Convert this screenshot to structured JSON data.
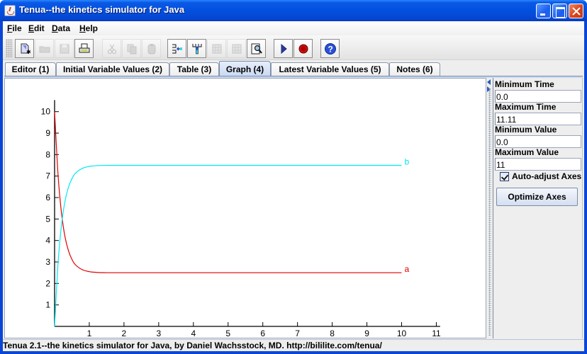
{
  "window": {
    "title": "Tenua--the kinetics simulator for Java",
    "controls": [
      "minimize",
      "maximize",
      "close"
    ]
  },
  "menubar": {
    "items": [
      {
        "label": "File",
        "mnemonic": "F",
        "rest": "ile"
      },
      {
        "label": "Edit",
        "mnemonic": "E",
        "rest": "dit"
      },
      {
        "label": "Data",
        "mnemonic": "D",
        "rest": "ata"
      },
      {
        "label": "Help",
        "mnemonic": "H",
        "rest": "elp"
      }
    ]
  },
  "toolbar": {
    "buttons": [
      {
        "name": "new-document",
        "icon": "new-document-icon",
        "enabled": true
      },
      {
        "name": "open",
        "icon": "folder-open-icon",
        "enabled": false
      },
      {
        "name": "save",
        "icon": "floppy-disk-icon",
        "enabled": false
      },
      {
        "name": "print",
        "icon": "printer-icon",
        "enabled": true
      },
      {
        "name": "cut",
        "icon": "scissors-icon",
        "enabled": false
      },
      {
        "name": "copy",
        "icon": "copy-icon",
        "enabled": false
      },
      {
        "name": "paste",
        "icon": "paste-icon",
        "enabled": false
      },
      {
        "name": "insert-column",
        "icon": "insert-column-icon",
        "enabled": true
      },
      {
        "name": "insert-row",
        "icon": "insert-row-icon",
        "enabled": true
      },
      {
        "name": "table-a",
        "icon": "table-icon",
        "enabled": false
      },
      {
        "name": "table-b",
        "icon": "table-icon",
        "enabled": false
      },
      {
        "name": "inspect",
        "icon": "magnify-document-icon",
        "enabled": true
      },
      {
        "name": "run",
        "icon": "play-icon",
        "enabled": true
      },
      {
        "name": "stop",
        "icon": "stop-icon",
        "enabled": true
      },
      {
        "name": "help",
        "icon": "help-icon",
        "enabled": true
      }
    ]
  },
  "tabs": [
    {
      "label": "Editor (1)",
      "selected": false
    },
    {
      "label": "Initial Variable Values (2)",
      "selected": false
    },
    {
      "label": "Table (3)",
      "selected": false
    },
    {
      "label": "Graph (4)",
      "selected": true
    },
    {
      "label": "Latest Variable Values (5)",
      "selected": false
    },
    {
      "label": "Notes (6)",
      "selected": false
    }
  ],
  "side_panel": {
    "min_time_label": "Minimum Time",
    "min_time_value": "0.0",
    "max_time_label": "Maximum Time",
    "max_time_value": "11.11",
    "min_value_label": "Minimum Value",
    "min_value_value": "0.0",
    "max_value_label": "Maximum Value",
    "max_value_value": "11",
    "auto_adjust_label": "Auto-adjust Axes",
    "auto_adjust_checked": true,
    "optimize_button": "Optimize Axes"
  },
  "statusbar": {
    "text": "Tenua 2.1--the kinetics simulator for Java, by Daniel Wachsstock, MD. http://bililite.com/tenua/"
  },
  "chart_data": {
    "type": "line",
    "title": "",
    "xlabel": "",
    "ylabel": "",
    "xlim": [
      0,
      11.11
    ],
    "ylim": [
      0,
      11
    ],
    "x_ticks": [
      1,
      2,
      3,
      4,
      5,
      6,
      7,
      8,
      9,
      10,
      11
    ],
    "y_ticks": [
      1,
      2,
      3,
      4,
      5,
      6,
      7,
      8,
      9,
      10
    ],
    "grid": false,
    "legend": "end-of-line labels",
    "x": [
      0,
      0.1,
      0.2,
      0.3,
      0.4,
      0.5,
      0.6,
      0.8,
      1.0,
      1.25,
      1.5,
      2.0,
      3.0,
      4.0,
      5.0,
      6.0,
      7.0,
      8.0,
      9.0,
      10.0
    ],
    "series": [
      {
        "name": "a",
        "color": "#e00000",
        "values": [
          10.0,
          7.05,
          5.26,
          4.17,
          3.52,
          3.12,
          2.87,
          2.64,
          2.55,
          2.51,
          2.5,
          2.5,
          2.5,
          2.5,
          2.5,
          2.5,
          2.5,
          2.5,
          2.5,
          2.5
        ]
      },
      {
        "name": "b",
        "color": "#00e8f0",
        "values": [
          0.0,
          2.95,
          4.74,
          5.83,
          6.48,
          6.88,
          7.13,
          7.36,
          7.45,
          7.49,
          7.5,
          7.5,
          7.5,
          7.5,
          7.5,
          7.5,
          7.5,
          7.5,
          7.5,
          7.5
        ]
      }
    ]
  }
}
